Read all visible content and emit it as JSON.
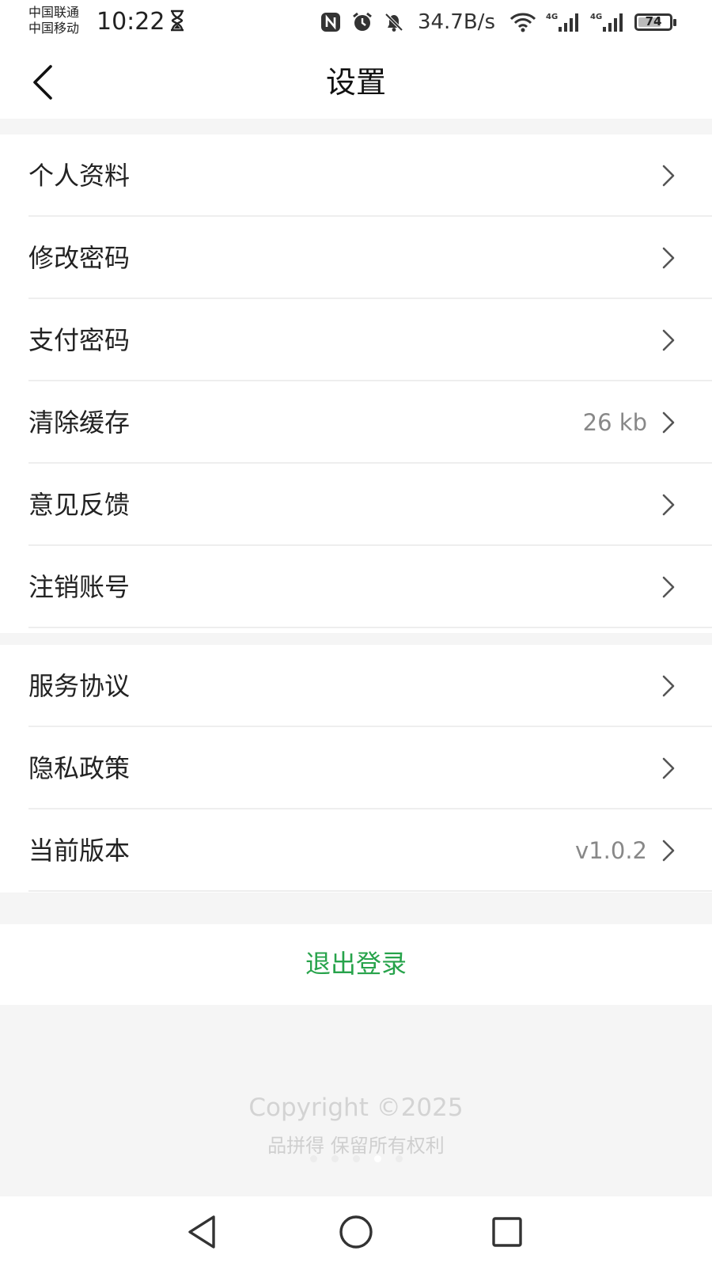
{
  "status_bar": {
    "carrier_1": "中国联通",
    "carrier_2": "中国移动",
    "time": "10:22",
    "net_speed": "34.7B/s",
    "network_label": "4G",
    "battery": "74",
    "battery_level": 0.74,
    "icons": [
      "hourglass-icon",
      "nfc-icon",
      "alarm-icon",
      "mute-bell-icon",
      "wifi-icon",
      "signal-icon"
    ]
  },
  "header": {
    "title": "设置",
    "back_icon": "chevron-left-icon"
  },
  "group_1": [
    {
      "label": "个人资料",
      "value": ""
    },
    {
      "label": "修改密码",
      "value": ""
    },
    {
      "label": "支付密码",
      "value": ""
    },
    {
      "label": "清除缓存",
      "value": "26 kb"
    },
    {
      "label": "意见反馈",
      "value": ""
    },
    {
      "label": "注销账号",
      "value": ""
    }
  ],
  "group_2": [
    {
      "label": "服务协议",
      "value": ""
    },
    {
      "label": "隐私政策",
      "value": ""
    },
    {
      "label": "当前版本",
      "value": "v1.0.2"
    }
  ],
  "logout_label": "退出登录",
  "footer": {
    "copyright": "Copyright ©2025",
    "rights": "品拼得 保留所有权利"
  },
  "colors": {
    "accent": "#27a34b",
    "background": "#f5f5f5",
    "card": "#ffffff",
    "value_text": "#888888"
  }
}
